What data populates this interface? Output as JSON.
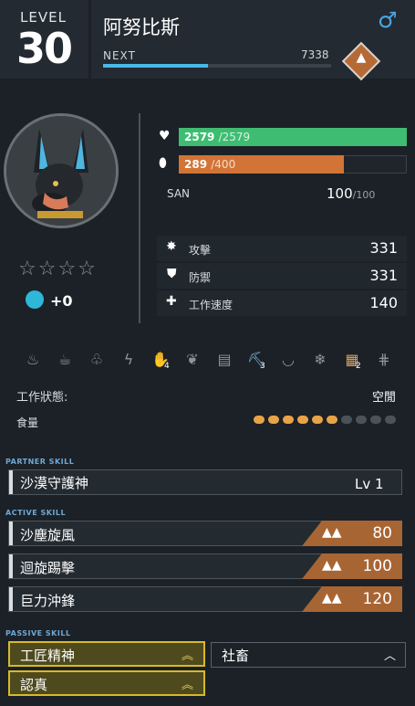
{
  "header": {
    "level_label": "LEVEL",
    "level": "30",
    "name": "阿努比斯",
    "gender_symbol": "♂",
    "next_label": "NEXT",
    "next_value": "7338",
    "next_progress": 0.46
  },
  "vitals": {
    "hp": "2579",
    "hp_max": "/2579",
    "hp_fraction": 1.0,
    "food": "289",
    "food_max": "/400",
    "food_fraction": 0.7225,
    "san_label": "SAN",
    "san": "100",
    "san_max": "/100"
  },
  "stats": [
    {
      "icon": "attack-icon",
      "label": "攻擊",
      "value": "331"
    },
    {
      "icon": "defense-icon",
      "label": "防禦",
      "value": "331"
    },
    {
      "icon": "work-speed-icon",
      "label": "工作速度",
      "value": "140"
    }
  ],
  "rank": {
    "stars_total": 4,
    "stars_filled": 0,
    "souls": "+0"
  },
  "work_suitability": [
    {
      "icon": "kindling-icon",
      "level": ""
    },
    {
      "icon": "watering-icon",
      "level": ""
    },
    {
      "icon": "planting-icon",
      "level": ""
    },
    {
      "icon": "electricity-icon",
      "level": ""
    },
    {
      "icon": "handiwork-icon",
      "level": "4"
    },
    {
      "icon": "gathering-icon",
      "level": ""
    },
    {
      "icon": "lumbering-icon",
      "level": ""
    },
    {
      "icon": "mining-icon",
      "level": "3"
    },
    {
      "icon": "medicine-icon",
      "level": ""
    },
    {
      "icon": "cooling-icon",
      "level": ""
    },
    {
      "icon": "transporting-icon",
      "level": "2"
    },
    {
      "icon": "farming-icon",
      "level": ""
    }
  ],
  "work_status_label": "工作狀態:",
  "work_status": "空閒",
  "food_label": "食量",
  "food_appetite": {
    "total": 10,
    "filled": 6
  },
  "partner_skill": {
    "section": "PARTNER SKILL",
    "name": "沙漠守護神",
    "level": "Lv  1"
  },
  "active_skills": {
    "section": "ACTIVE SKILL",
    "items": [
      {
        "name": "沙塵旋風",
        "power": "80"
      },
      {
        "name": "迴旋踢擊",
        "power": "100"
      },
      {
        "name": "巨力沖鋒",
        "power": "120"
      }
    ]
  },
  "passive_skills": {
    "section": "PASSIVE SKILL",
    "items": [
      {
        "name": "工匠精神",
        "tier": "gold"
      },
      {
        "name": "社畜",
        "tier": "dark"
      },
      {
        "name": "認真",
        "tier": "gold"
      }
    ]
  },
  "colors": {
    "hp": "#3ebd72",
    "food": "#d27436",
    "exp": "#49b8e6",
    "skill_power": "#a86534",
    "passive_gold": "#d7b92b"
  }
}
